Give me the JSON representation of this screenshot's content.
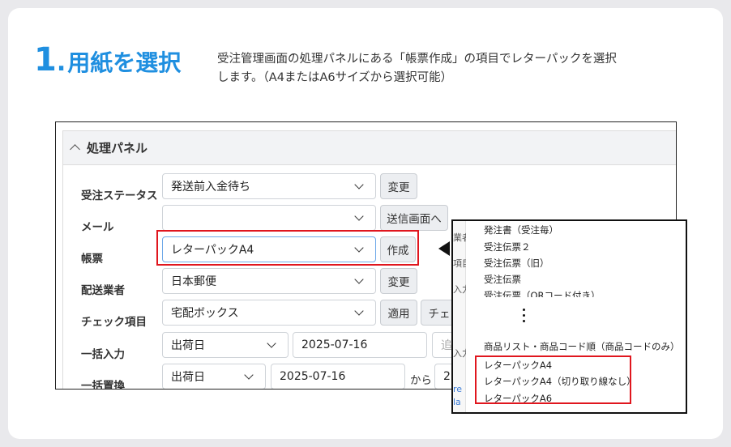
{
  "step": {
    "number": "1",
    "dot": ".",
    "title": "用紙を選択",
    "description_line1": "受注管理画面の処理パネルにある「帳票作成」の項目でレターパックを選択",
    "description_line2": "します。（A4またはA6サイズから選択可能）"
  },
  "panel": {
    "title": "処理パネル",
    "rows": [
      {
        "label": "受注ステータス",
        "select": "発送前入金待ち",
        "button": "変更"
      },
      {
        "label": "メール",
        "select": "",
        "button": "送信画面へ"
      },
      {
        "label": "帳票",
        "select": "レターパックA4",
        "button": "作成"
      },
      {
        "label": "配送業者",
        "select": "日本郵便",
        "button": "変更"
      },
      {
        "label": "チェック項目",
        "select": "宅配ボックス",
        "button": "適用",
        "button2": "チェ"
      },
      {
        "label": "一括入力",
        "select": "出荷日",
        "date": "2025-07-16",
        "extra": "追"
      },
      {
        "label": "一括置換",
        "select": "出荷日",
        "date": "2025-07-16",
        "from": "から",
        "extra": "2("
      }
    ]
  },
  "popup": {
    "background_fragments": [
      "業者",
      "項目",
      "入力",
      "入力",
      "re",
      "la"
    ],
    "items_top": [
      "発注書（受注毎）",
      "受注伝票２",
      "受注伝票（旧）",
      "受注伝票",
      "受注伝票（QRコード付き）"
    ],
    "items_bottom": [
      "商品リスト・商品コード順（商品コードのみ）",
      "レターパックA4",
      "レターパックA4（切り取り線なし）",
      "レターパックA6"
    ]
  }
}
